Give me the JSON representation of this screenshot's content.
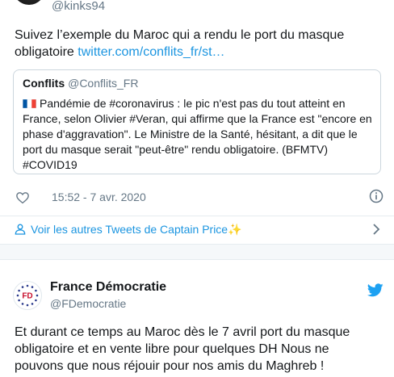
{
  "top_tweet": {
    "handle": "@kinks94",
    "text": "Suivez l’exemple du Maroc qui a rendu le port du masque obligatoire ",
    "link": "twitter.com/conflits_fr/st…",
    "quoted": {
      "name": "Conflits",
      "handle": "@Conflits_FR",
      "text": "Pandémie de #coronavirus : le pic n'est pas du tout atteint en France, selon Olivier #Veran, qui affirme que la France est \"encore en phase d'aggravation\". Le Ministre de la Santé, hésitant, a dit que le port du masque serait \"peut-être\" rendu obligatoire. (BFMTV) #COVID19"
    },
    "timestamp": "15:52 - 7 avr. 2020"
  },
  "more_tweets": {
    "label": "Voir les autres Tweets de Captain Price",
    "emoji": "✨"
  },
  "second_tweet": {
    "name": "France Démocratie",
    "handle": "@FDemocratie",
    "avatar_text": "FD",
    "text": "Et durant ce temps au Maroc dès le 7 avril port du masque obligatoire et en vente libre pour quelques DH Nous ne pouvons que nous réjouir pour nos amis du Maghreb !"
  },
  "icons": {
    "heart": "heart-icon",
    "info": "info-icon",
    "user": "user-icon",
    "chevron": "chevron-right-icon",
    "twitter": "twitter-bird-icon",
    "flag": "france-flag-icon"
  },
  "colors": {
    "link": "#1b95e0",
    "secondary_text": "#657786",
    "border": "#ccd6dd",
    "twitter_blue": "#1da1f2"
  }
}
